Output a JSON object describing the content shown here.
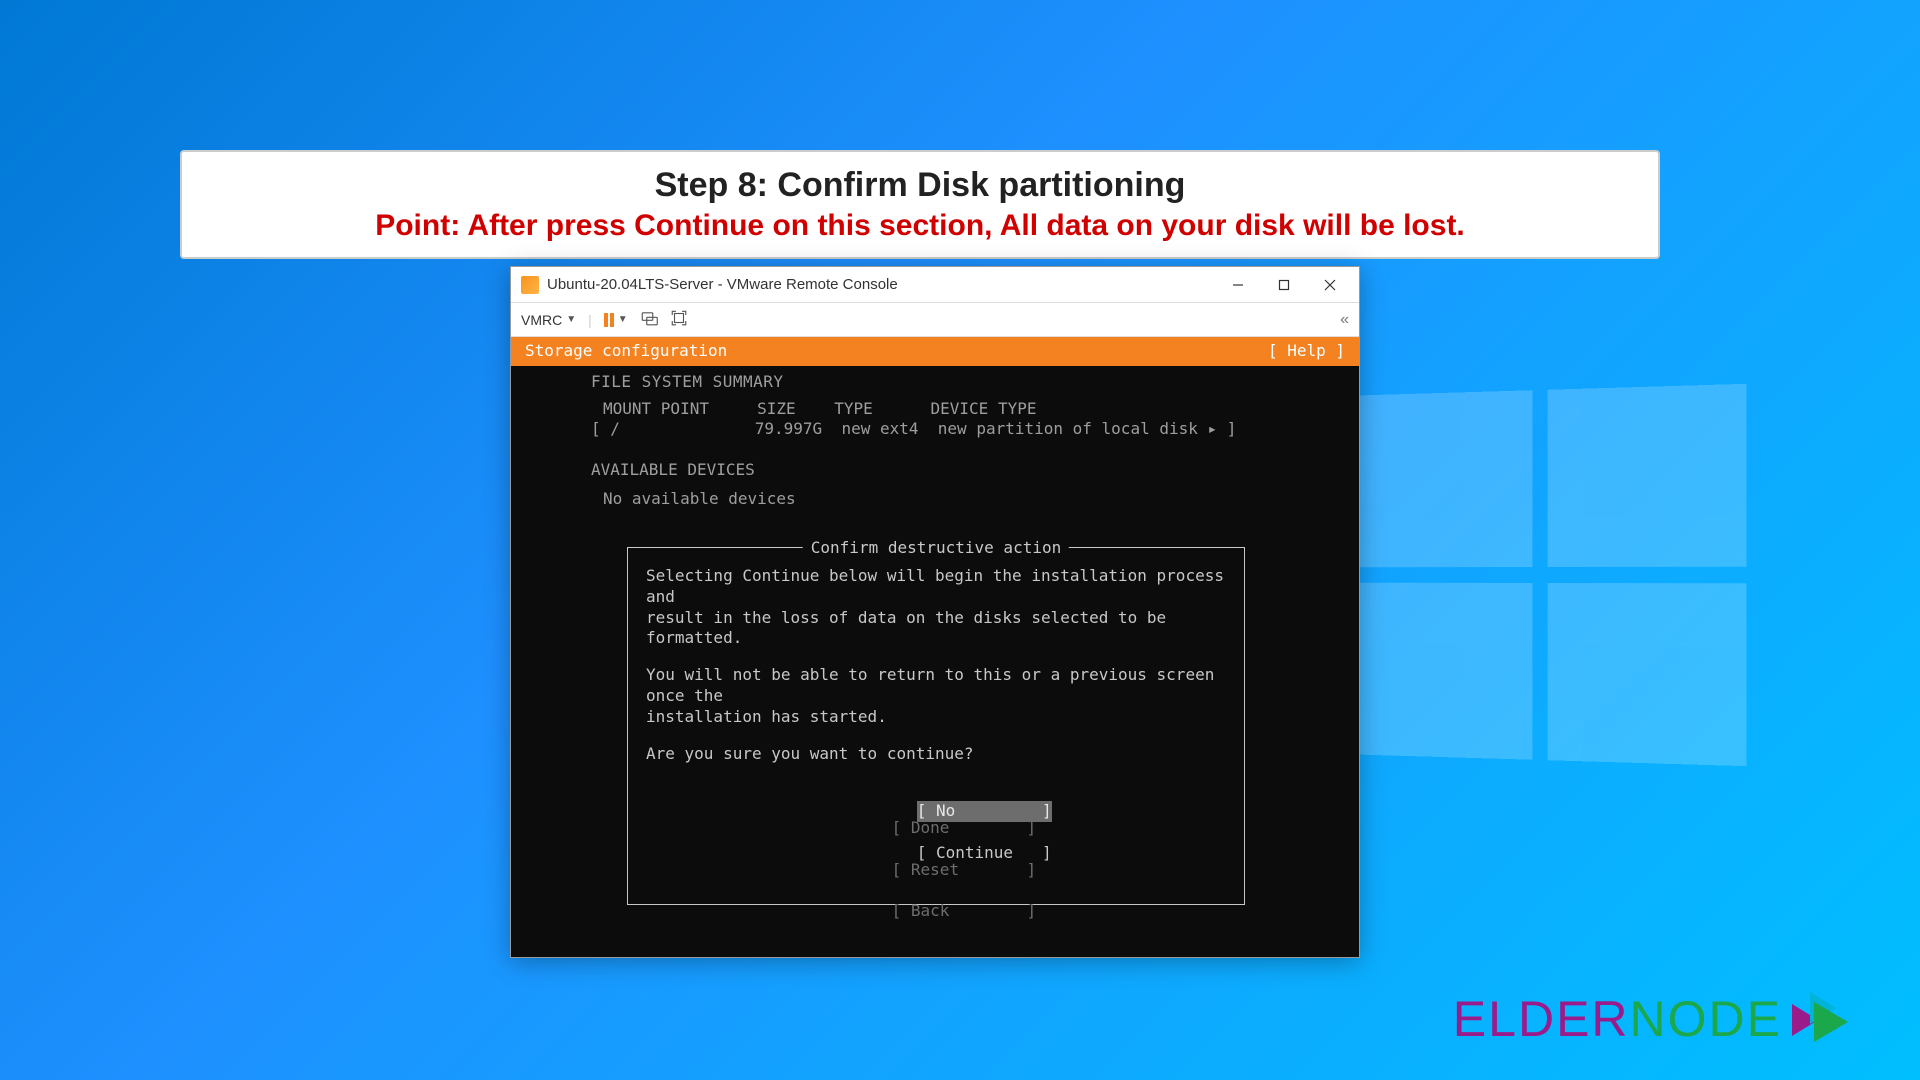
{
  "instruction": {
    "step": "Step 8: Confirm Disk partitioning",
    "point": "Point: After press Continue on this section, All data on your disk will be lost."
  },
  "window": {
    "title": "Ubuntu-20.04LTS-Server - VMware Remote Console",
    "menu_label": "VMRC",
    "collapse": "«"
  },
  "installer": {
    "header_title": "Storage configuration",
    "help_label": "[ Help ]",
    "fs_summary_title": "FILE SYSTEM SUMMARY",
    "columns": "MOUNT POINT     SIZE    TYPE      DEVICE TYPE",
    "row": "[ /              79.997G  new ext4  new partition of local disk ▸ ]",
    "avail_title": "AVAILABLE DEVICES",
    "avail_none": "No available devices",
    "dialog": {
      "title": "Confirm destructive action",
      "p1": "Selecting Continue below will begin the installation process and\nresult in the loss of data on the disks selected to be formatted.",
      "p2": "You will not be able to return to this or a previous screen once the\ninstallation has started.",
      "p3": "Are you sure you want to continue?",
      "no": "[ No         ]",
      "cont": "[ Continue   ]"
    },
    "bottom": {
      "done": "[ Done        ]",
      "reset": "[ Reset       ]",
      "back": "[ Back        ]"
    }
  },
  "brand": {
    "elder": "ELDER",
    "node": "NODE"
  }
}
